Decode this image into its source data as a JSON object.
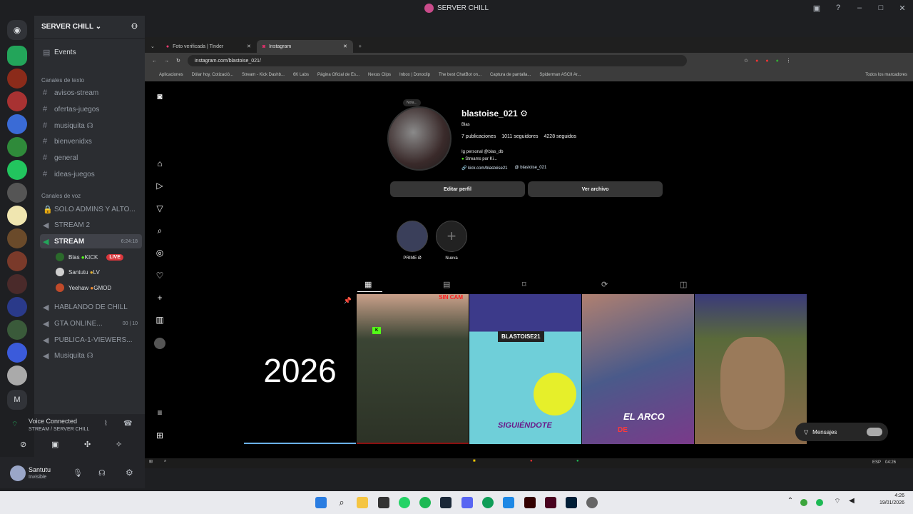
{
  "window_title": "SERVER CHILL",
  "server": {
    "name": "SERVER CHILL"
  },
  "sidebar": {
    "events": "Events",
    "text_category": "Canales de texto",
    "text_channels": [
      "avisos-stream",
      "ofertas-juegos",
      "musiquita",
      "bienvenidxs",
      "general",
      "ideas-juegos"
    ],
    "voice_category": "Canales de voz",
    "voice_channels": [
      "SOLO ADMINS Y ALTO...",
      "STREAM 2",
      "STREAM",
      "HABLANDO DE CHILL",
      "GTA ONLINE...",
      "PUBLICA-1-VIEWERS...",
      "Musiquita"
    ],
    "stream_time": "6:24:18",
    "stream_users": [
      {
        "name": "Blas",
        "tag": "KICK",
        "badge": "LIVE"
      },
      {
        "name": "Santutu",
        "tag": "LV"
      },
      {
        "name": "Yeehaw",
        "tag": "GMOD"
      }
    ],
    "gta_counts": [
      "00",
      "10"
    ]
  },
  "voice_connected": {
    "title": "Voice Connected",
    "sub": "STREAM / SERVER CHILL"
  },
  "user": {
    "name": "Santutu",
    "status": "Invisible"
  },
  "browser": {
    "tabs": [
      {
        "label": "Foto verificada | Tinder"
      },
      {
        "label": "Instagram"
      }
    ],
    "url": "instagram.com/blastoise_021/",
    "bookmarks": [
      "Aplicaciones",
      "Dólar hoy, Cotizació...",
      "Stream - Kick Dashb...",
      "6K Labs",
      "Página Oficial de Es...",
      "Nexus Clips",
      "Inbox | Donoclip",
      "The best ChatBot on...",
      "Captura de pantalla...",
      "Spiderman ASCII Ar...",
      "Todos los marcadores"
    ]
  },
  "profile": {
    "username": "blastoise_021",
    "name": "Blas",
    "posts": "7 publicaciones",
    "followers": "1011 seguidores",
    "following": "4228 seguidos",
    "bio1": "Ig personal @blas_db",
    "bio2": "Streams por Ki...",
    "link": "kick.com/blastoise21",
    "threads": "blastoise_021",
    "note": "Nota...",
    "edit_btn": "Editar perfil",
    "archive_btn": "Ver archivo",
    "highlights": [
      "PRIME Ø",
      "Nueva"
    ],
    "post1_text": "2026",
    "post2_text": "SIN CAM",
    "post3_text": "BLASTOISE21",
    "post3_sub": "SIGUIÉNDOTE",
    "post4_text": "EL ARCO",
    "post4_sub": "DE",
    "messages": "Mensajes"
  },
  "inner_taskbar": {
    "lang": "ESP",
    "time": "04:26"
  },
  "taskbar": {
    "time": "4:26",
    "date": "19/01/2026"
  }
}
